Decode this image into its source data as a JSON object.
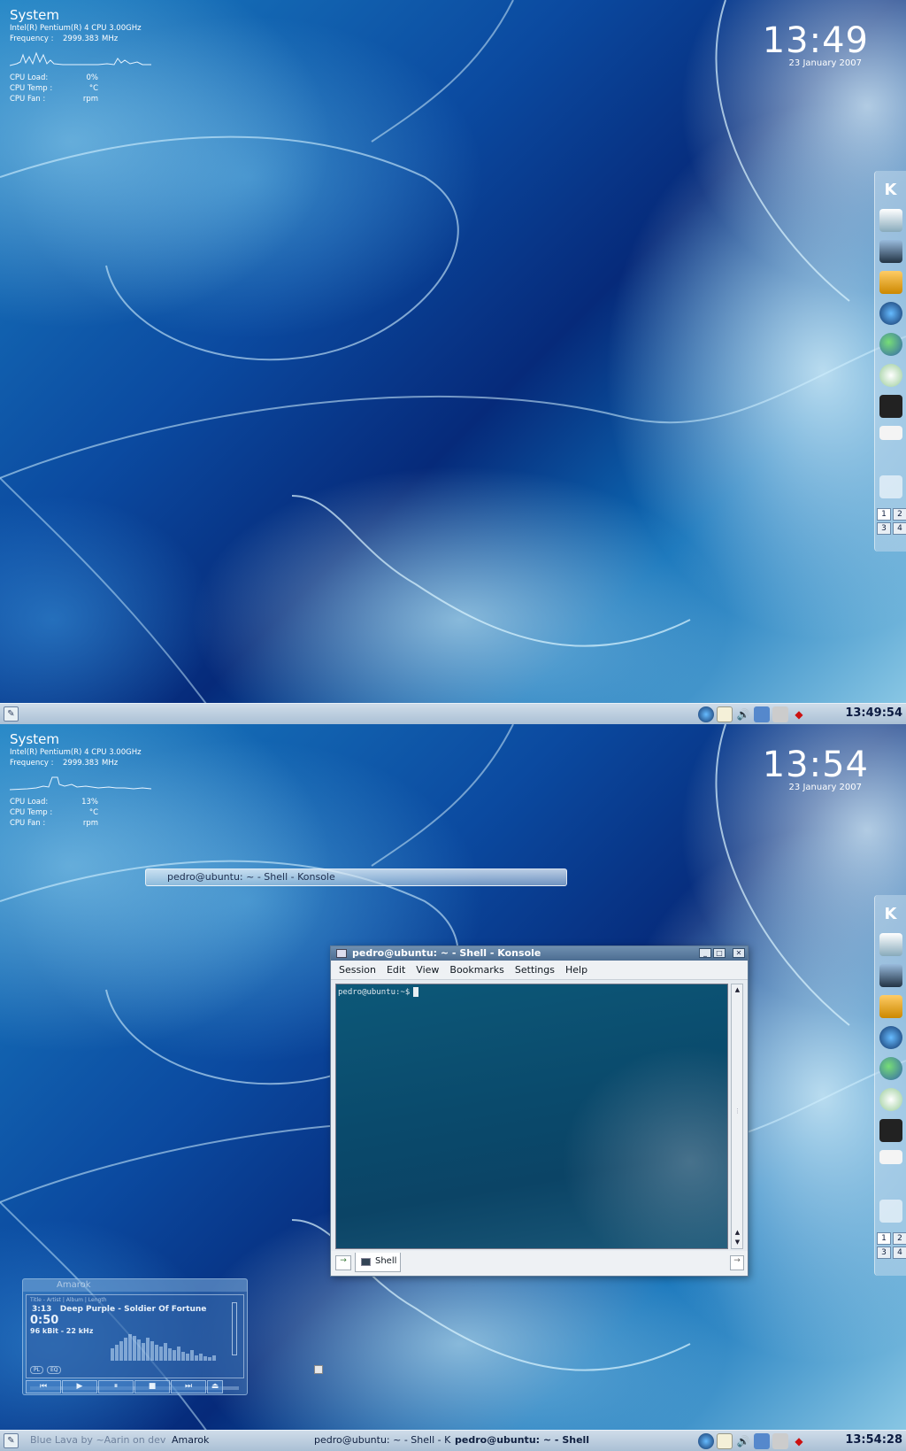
{
  "colors": {
    "taskbar": "#b8cadb",
    "wallpaper_dark": "#062a7a",
    "wallpaper_light": "#8fcbe6",
    "terminal_bg": "#0a4a6c"
  },
  "screen1": {
    "sysmon": {
      "title": "System",
      "cpu_model": "Intel(R) Pentium(R) 4 CPU 3.00GHz",
      "frequency_label": "Frequency :",
      "frequency_value": "2999.383",
      "frequency_unit": "MHz",
      "cpu_load_label": "CPU Load:",
      "cpu_load_value": "0%",
      "cpu_temp_label": "CPU Temp :",
      "cpu_temp_unit": "°C",
      "cpu_fan_label": "CPU Fan :",
      "cpu_fan_unit": "rpm"
    },
    "clock": {
      "time": "13:49",
      "date": "23 January 2007"
    },
    "taskbar": {
      "clock": "13:49:54"
    },
    "pager": [
      "1",
      "2",
      "3",
      "4"
    ]
  },
  "screen2": {
    "sysmon": {
      "title": "System",
      "cpu_model": "Intel(R) Pentium(R) 4 CPU 3.00GHz",
      "frequency_label": "Frequency :",
      "frequency_value": "2999.383",
      "frequency_unit": "MHz",
      "cpu_load_label": "CPU Load:",
      "cpu_load_value": "13%",
      "cpu_temp_label": "CPU Temp :",
      "cpu_temp_unit": "°C",
      "cpu_fan_label": "CPU Fan :",
      "cpu_fan_unit": "rpm"
    },
    "clock": {
      "time": "13:54",
      "date": "23 January 2007"
    },
    "minibar": {
      "title": "pedro@ubuntu: ~ - Shell - Konsole"
    },
    "konsole": {
      "title": "pedro@ubuntu: ~ - Shell - Konsole",
      "menu": [
        "Session",
        "Edit",
        "View",
        "Bookmarks",
        "Settings",
        "Help"
      ],
      "prompt": "pedro@ubuntu:~$",
      "tab_label": "Shell"
    },
    "amarok": {
      "title": "Amarok",
      "header": "Title - Artist | Album | Length",
      "track_number": "3:13",
      "song": "Deep Purple - Soldier Of Fortune",
      "position": "0:50",
      "bitrate": "96 kBit - 22 kHz",
      "pl_label": "PL",
      "eq_label": "EQ"
    },
    "taskbar": {
      "task1": "Blue Lava by ~Aarin on dev",
      "task2": "Amarok",
      "task3": "pedro@ubuntu: ~ - Shell - K",
      "task4": "pedro@ubuntu: ~ - Shell",
      "clock": "13:54:28"
    },
    "pager": [
      "1",
      "2",
      "3",
      "4"
    ]
  }
}
